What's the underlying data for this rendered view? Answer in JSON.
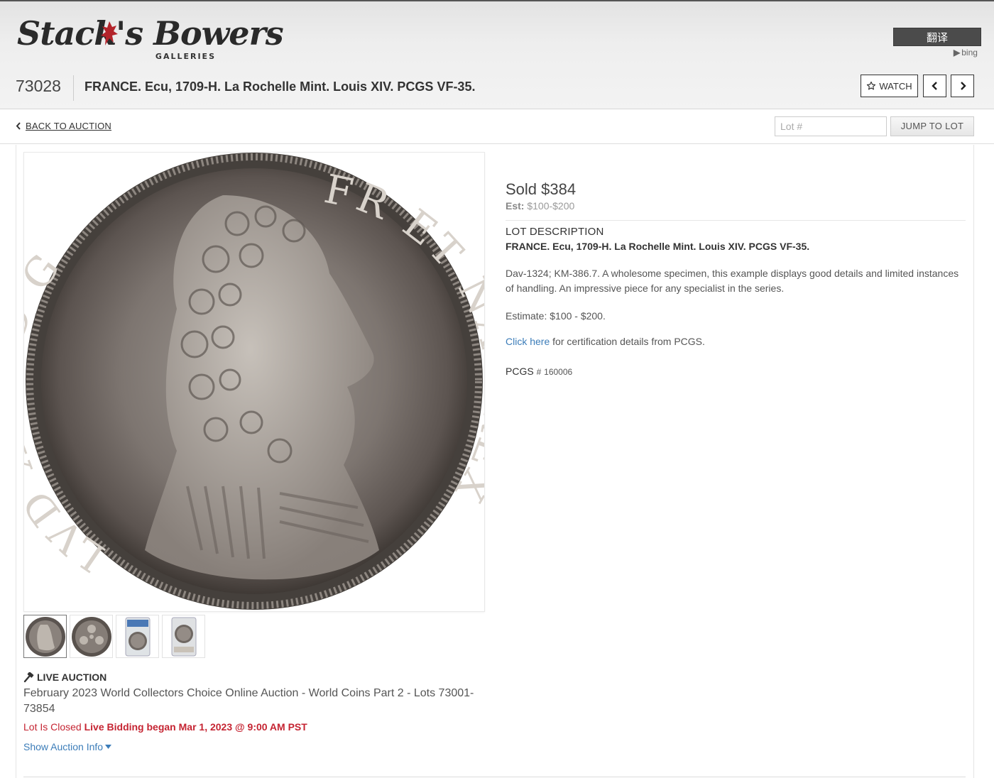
{
  "header": {
    "logo_text": "Stack's Bowers",
    "logo_sub": "GALLERIES",
    "translate_label": "翻译",
    "bing_label": "bing"
  },
  "lot": {
    "number": "73028",
    "title": "FRANCE. Ecu, 1709-H. La Rochelle Mint. Louis XIV. PCGS VF-35.",
    "watch_label": "WATCH"
  },
  "subnav": {
    "back_label": "BACK TO AUCTION",
    "lot_placeholder": "Lot #",
    "jump_label": "JUMP TO LOT"
  },
  "thumbnails": [
    {
      "name": "coin-obverse-thumb"
    },
    {
      "name": "coin-reverse-thumb"
    },
    {
      "name": "slab-front-thumb"
    },
    {
      "name": "slab-back-thumb"
    }
  ],
  "auction": {
    "type_label": "LIVE AUCTION",
    "name": "February 2023 World Collectors Choice Online Auction - World Coins Part 2 - Lots 73001-73854",
    "status_closed": "Lot Is Closed",
    "status_bidding": "Live Bidding began Mar 1, 2023 @ 9:00 AM PST",
    "show_info_label": "Show Auction Info"
  },
  "sale": {
    "sold_text": "Sold $384",
    "est_label": "Est:",
    "est_value": "$100-$200"
  },
  "description": {
    "label": "LOT DESCRIPTION",
    "title": "FRANCE. Ecu, 1709-H. La Rochelle Mint. Louis XIV. PCGS VF-35.",
    "body": "Dav-1324; KM-386.7. A wholesome specimen, this example displays good details and limited instances of handling. An impressive piece for any specialist in the series.",
    "estimate": "Estimate: $100 - $200.",
    "cert_link": "Click here",
    "cert_rest": "for certification details from PCGS.",
    "pcgs_label": "PCGS",
    "pcgs_hash": "#",
    "pcgs_number": "160006"
  },
  "coin_legend": {
    "left": "LVD XIIII D G",
    "right": "FR ET NAV REX"
  },
  "colors": {
    "accent_link": "#3c7db9",
    "status_red": "#c52432"
  }
}
